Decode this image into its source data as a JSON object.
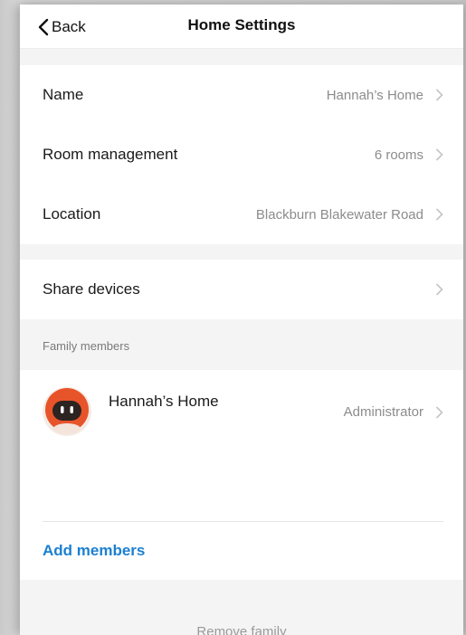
{
  "navbar": {
    "back_label": "Back",
    "title": "Home Settings"
  },
  "settings": [
    {
      "label": "Name",
      "value": "Hannah’s Home"
    },
    {
      "label": "Room management",
      "value": "6 rooms"
    },
    {
      "label": "Location",
      "value": "Blackburn Blakewater Road"
    }
  ],
  "share": {
    "label": "Share devices"
  },
  "family": {
    "caption": "Family members",
    "members": [
      {
        "name": "Hannah’s Home",
        "role": "Administrator",
        "avatar_icon": "robot-avatar-icon"
      }
    ],
    "add_label": "Add members",
    "remove_label": "Remove family"
  },
  "colors": {
    "accent": "#1b7fd2",
    "avatar_orange": "#e8542a",
    "section_bg": "#f4f4f4"
  }
}
